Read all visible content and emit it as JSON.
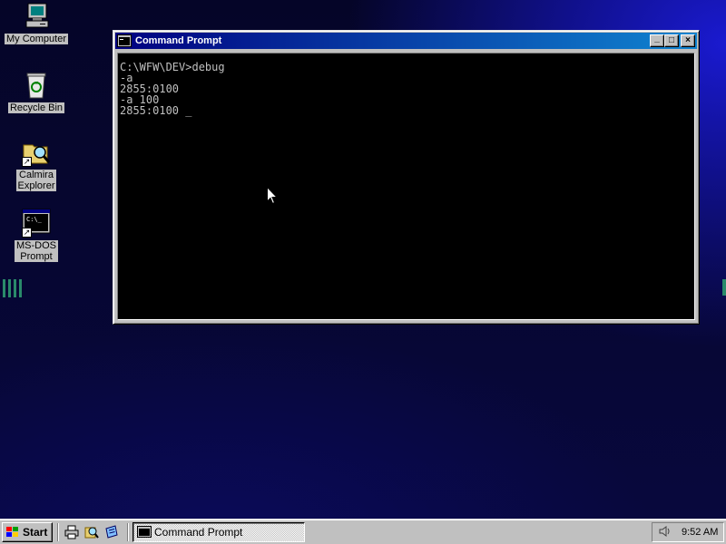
{
  "desktop": {
    "icons": [
      {
        "label": "My Computer",
        "icon": "computer-icon"
      },
      {
        "label": "Recycle Bin",
        "icon": "recycle-bin-icon"
      },
      {
        "label": "Calmira\nExplorer",
        "icon": "explorer-icon"
      },
      {
        "label": "MS-DOS\nPrompt",
        "icon": "msdos-icon"
      }
    ]
  },
  "window": {
    "title": "Command Prompt",
    "minimize": "_",
    "maximize": "□",
    "close": "×",
    "console_lines": [
      "C:\\WFW\\DEV>debug",
      "-a",
      "2855:0100",
      "-a 100",
      "2855:0100 _"
    ]
  },
  "taskbar": {
    "start_label": "Start",
    "quick_launch": [
      "printer-icon",
      "magnifier-icon",
      "note-icon"
    ],
    "task_button_label": "Command Prompt",
    "clock": "9:52 AM",
    "tray_icon": "speaker-icon"
  },
  "colors": {
    "title_bar_start": "#000080",
    "title_bar_end": "#1084d0",
    "face": "#c0c0c0",
    "console_bg": "#000000",
    "console_text": "#c0c0c0"
  }
}
